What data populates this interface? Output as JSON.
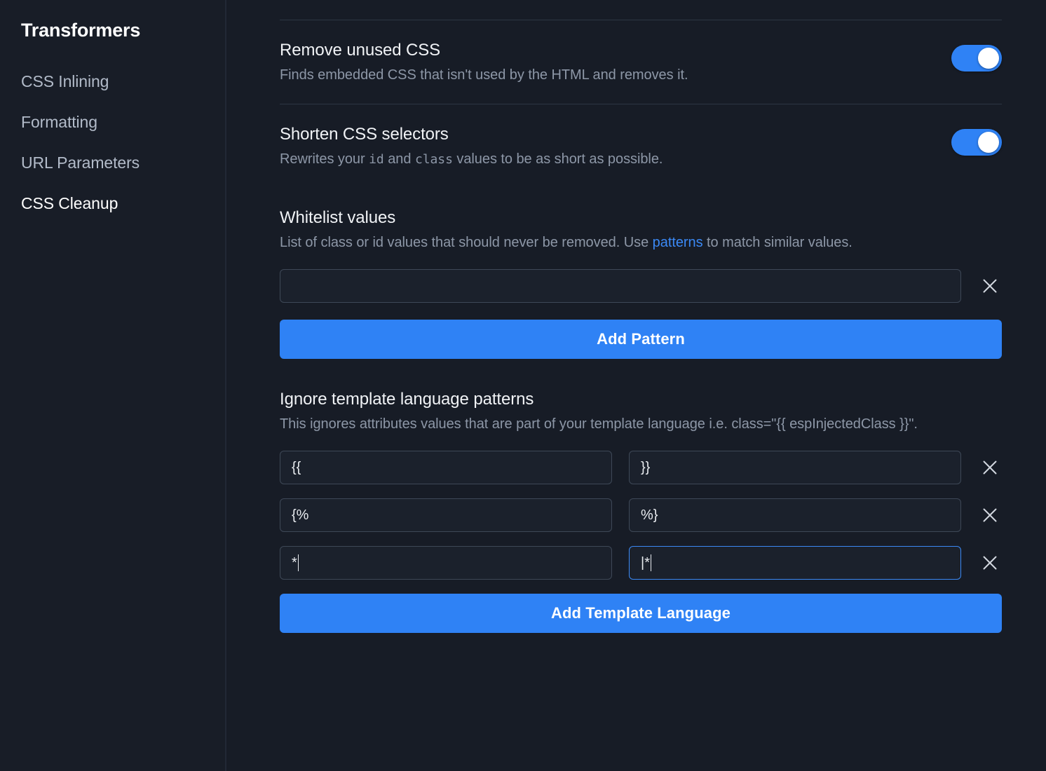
{
  "sidebar": {
    "title": "Transformers",
    "items": [
      {
        "label": "CSS Inlining",
        "active": false
      },
      {
        "label": "Formatting",
        "active": false
      },
      {
        "label": "URL Parameters",
        "active": false
      },
      {
        "label": "CSS Cleanup",
        "active": true
      }
    ]
  },
  "settings": {
    "remove_unused_css": {
      "title": "Remove unused CSS",
      "description": "Finds embedded CSS that isn't used by the HTML and removes it.",
      "toggle_state": "on"
    },
    "shorten_css_selectors": {
      "title": "Shorten CSS selectors",
      "desc_part1": "Rewrites your ",
      "desc_mono1": "id",
      "desc_part2": " and ",
      "desc_mono2": "class",
      "desc_part3": " values to be as short as possible.",
      "toggle_state": "on"
    }
  },
  "whitelist": {
    "title": "Whitelist values",
    "desc_part1": "List of class or id values that should never be removed. Use ",
    "desc_link": "patterns",
    "desc_part2": " to match similar values.",
    "input_value": "",
    "input_placeholder": "",
    "remove_label": "close-icon",
    "add_button_label": "Add Pattern"
  },
  "template_language": {
    "title": "Ignore template language patterns",
    "description": "This ignores attributes values that are part of your template language i.e. class=\"{{ espInjectedClass }}\".",
    "rows": [
      {
        "open": "{{",
        "close": "}}",
        "open_focused": false,
        "close_focused": false,
        "open_caret": false,
        "close_caret": false
      },
      {
        "open": "{%",
        "close": "%}",
        "open_focused": false,
        "close_focused": false,
        "open_caret": false,
        "close_caret": false
      },
      {
        "open": "*",
        "close": "|*",
        "open_focused": false,
        "close_focused": true,
        "open_caret": true,
        "close_caret": true
      }
    ],
    "remove_label": "close-icon",
    "add_button_label": "Add Template Language"
  },
  "colors": {
    "page_background": "#171c26",
    "sidebar_background": "#181d27",
    "accent": "#2f82f5",
    "link": "#3b89f5",
    "heading_text": "#f1f3f6",
    "muted_text": "#8d97a7",
    "input_border": "#3e4857",
    "divider": "#2d3643"
  }
}
